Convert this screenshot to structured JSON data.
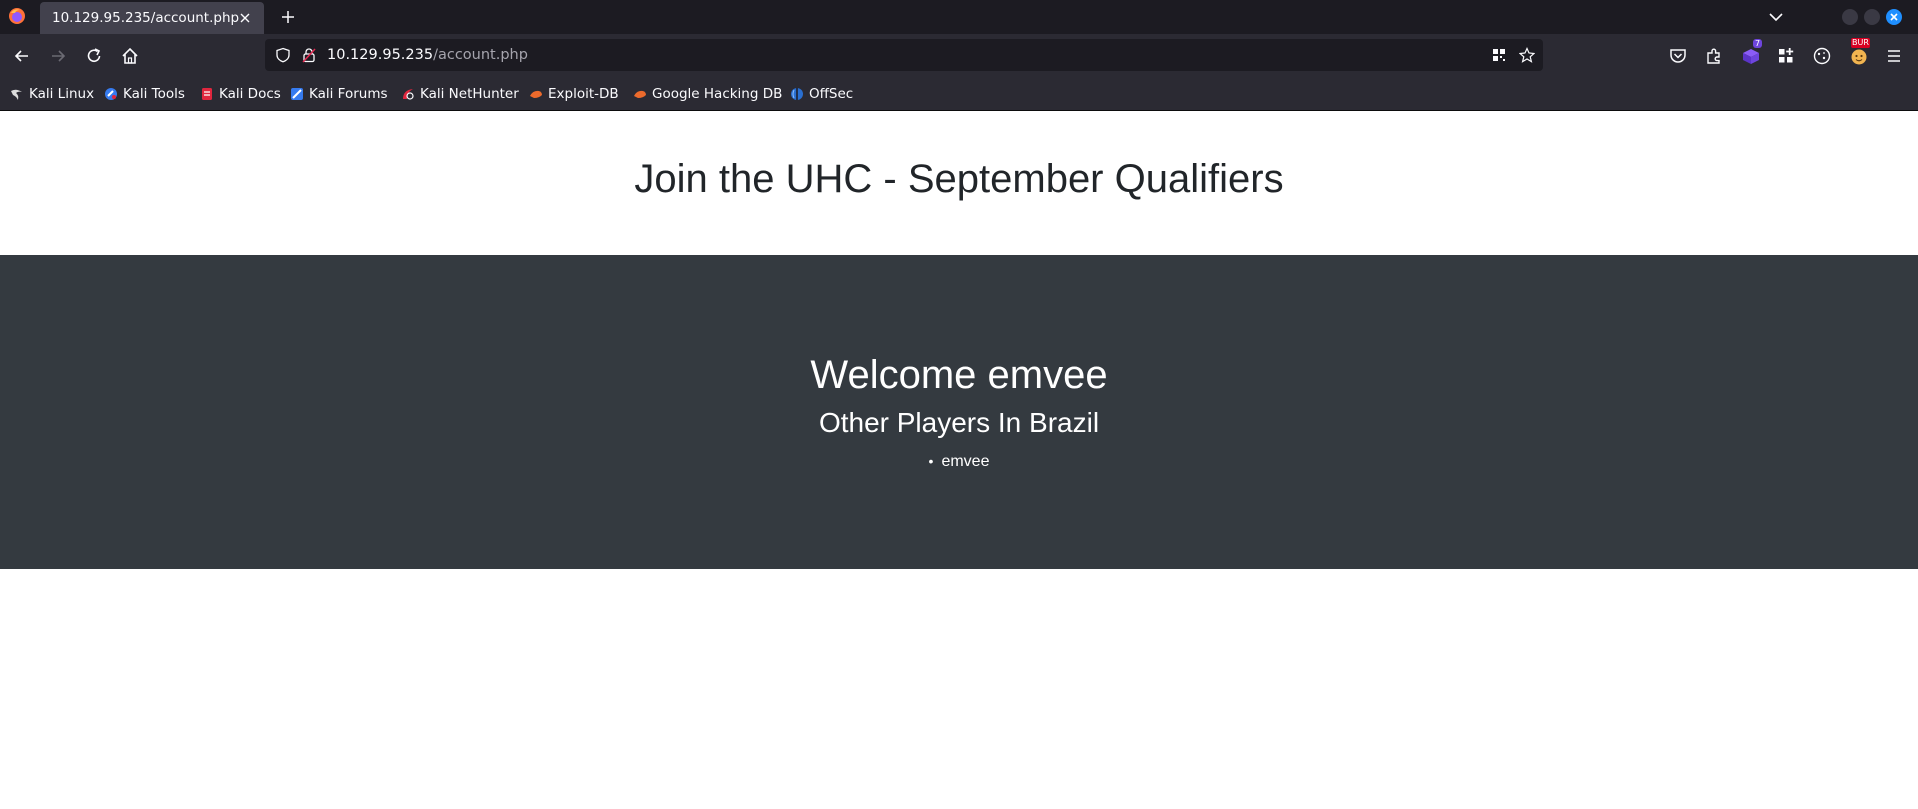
{
  "browser": {
    "tab": {
      "title": "10.129.95.235/account.php"
    },
    "url": {
      "host": "10.129.95.235",
      "path": "/account.php"
    },
    "extension_badges": {
      "counter": "7",
      "bur": "BUR"
    },
    "bookmarks": [
      {
        "label": "Kali Linux",
        "icon": "kali-dragon-icon"
      },
      {
        "label": "Kali Tools",
        "icon": "kali-tools-icon"
      },
      {
        "label": "Kali Docs",
        "icon": "kali-docs-icon"
      },
      {
        "label": "Kali Forums",
        "icon": "kali-forums-icon"
      },
      {
        "label": "Kali NetHunter",
        "icon": "nethunter-icon"
      },
      {
        "label": "Exploit-DB",
        "icon": "exploit-db-icon"
      },
      {
        "label": "Google Hacking DB",
        "icon": "ghdb-icon"
      },
      {
        "label": "OffSec",
        "icon": "offsec-icon"
      }
    ]
  },
  "page": {
    "title": "Join the UHC - September Qualifiers",
    "welcome": "Welcome emvee",
    "subtitle": "Other Players In Brazil",
    "players": [
      "emvee"
    ]
  },
  "colors": {
    "hero_bg": "#343a40",
    "chrome_dark": "#1c1b22",
    "chrome": "#2b2a33",
    "accent_close": "#1f8fff"
  }
}
